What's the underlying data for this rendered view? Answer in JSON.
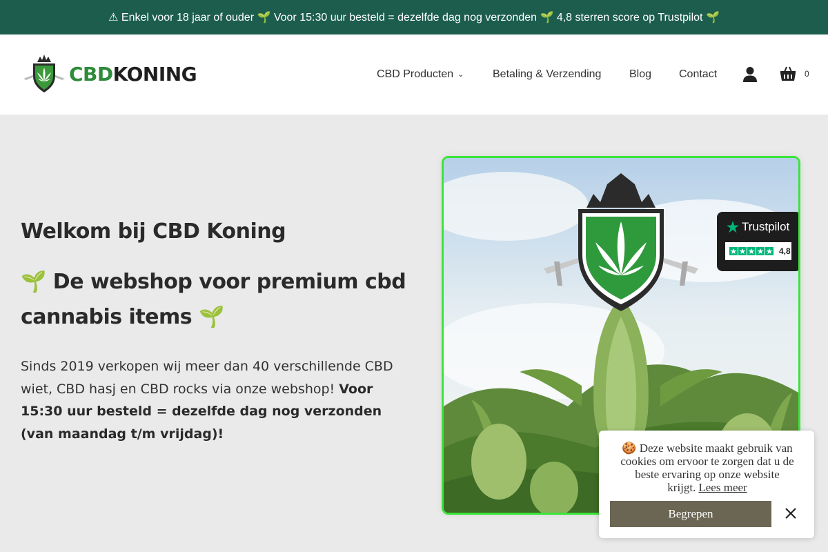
{
  "announcement": "⚠ Enkel voor 18 jaar of ouder 🌱 Voor 15:30 uur besteld = dezelfde dag nog verzonden 🌱 4,8 sterren score op Trustpilot 🌱",
  "logo": {
    "part1": "CBD",
    "part2": "KONING"
  },
  "nav": {
    "items": [
      {
        "label": "CBD Producten"
      },
      {
        "label": "Betaling & Verzending"
      },
      {
        "label": "Blog"
      },
      {
        "label": "Contact"
      }
    ],
    "dropdown_icon": "chevron-down-icon",
    "account_icon": "user-icon",
    "cart_icon": "basket-icon",
    "cart_count": "0"
  },
  "hero": {
    "title": "Welkom bij CBD Koning",
    "subtitle": "🌱 De webshop voor premium cbd cannabis items 🌱",
    "text_regular": "Sinds 2019 verkopen wij meer dan 40 verschillende CBD wiet, CBD hasj en CBD rocks via onze webshop!",
    "text_bold": "Voor 15:30 uur besteld = dezelfde dag nog verzonden (van maandag t/m vrijdag)!",
    "trustpilot": {
      "brand": "Trustpilot",
      "score": "4,8"
    }
  },
  "cookie": {
    "text": "🍪 Deze website maakt gebruik van cookies om ervoor te zorgen dat u de beste ervaring op onze website krijgt.",
    "link": "Lees meer",
    "button": "Begrepen",
    "close_icon": "close-icon"
  },
  "colors": {
    "topbar": "#1c5d4e",
    "accent_green": "#3be43b",
    "cookie_button": "#6a6653",
    "background": "#e9eae9"
  }
}
